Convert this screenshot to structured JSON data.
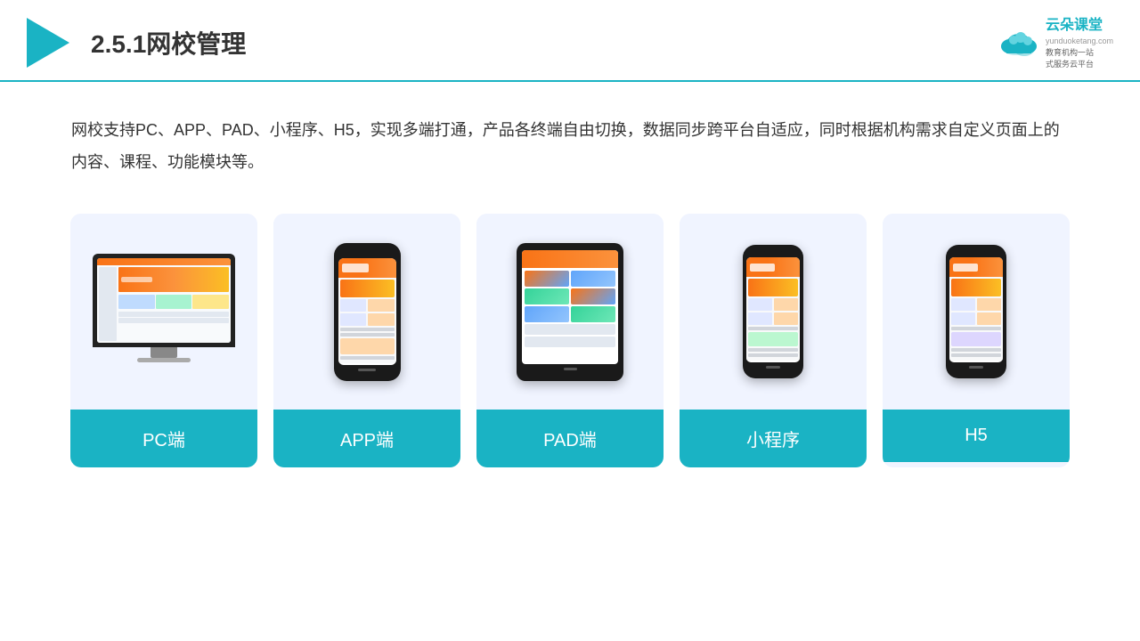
{
  "header": {
    "title": "2.5.1网校管理",
    "brand": {
      "name": "云朵课堂",
      "url": "yunduoketang.com",
      "tagline1": "教育机构一站",
      "tagline2": "式服务云平台"
    }
  },
  "description": "网校支持PC、APP、PAD、小程序、H5，实现多端打通，产品各终端自由切换，数据同步跨平台自适应，同时根据机构需求自定义页面上的内容、课程、功能模块等。",
  "cards": [
    {
      "id": "pc",
      "label": "PC端"
    },
    {
      "id": "app",
      "label": "APP端"
    },
    {
      "id": "pad",
      "label": "PAD端"
    },
    {
      "id": "miniprogram",
      "label": "小程序"
    },
    {
      "id": "h5",
      "label": "H5"
    }
  ],
  "colors": {
    "accent": "#1ab3c4",
    "cardBg": "#f0f4ff",
    "labelBg": "#1ab3c4",
    "labelText": "#ffffff"
  }
}
